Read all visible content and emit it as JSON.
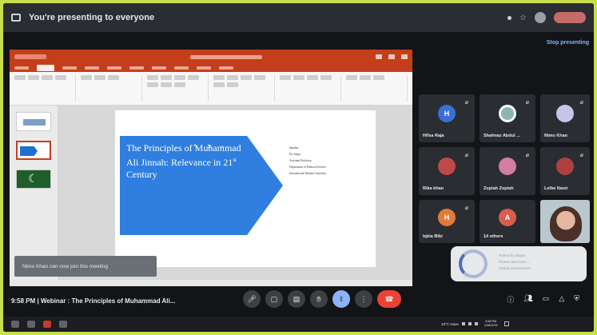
{
  "banner": {
    "text": "You're presenting to everyone",
    "stop_label": "Stop presenting"
  },
  "slide": {
    "title_main": "The Principles of Muhammad Ali Jinnah: Relevance in 21",
    "title_sup": "st",
    "title_end": "Century",
    "speaker_lines": [
      "Speaker",
      "Dr. Zaigu",
      "",
      "Assistant Professor,",
      "Department of Political Science",
      "International Women University"
    ]
  },
  "toast": {
    "text": "Nimo Khan can now join this meeting"
  },
  "participants": [
    {
      "name": "Hifsa Raja",
      "initial": "H",
      "color": "#3b6fd8"
    },
    {
      "name": "Shahnaz Abdul ...",
      "initial": "",
      "color": "#8bb6b0"
    },
    {
      "name": "Nimo Khan",
      "initial": "",
      "color": "#c9c3e8"
    },
    {
      "name": "Rika khan",
      "initial": "",
      "color": "#c04848"
    },
    {
      "name": "Zopiah Zopiah",
      "initial": "",
      "color": "#d37ca4"
    },
    {
      "name": "Lelbe Nasir",
      "initial": "",
      "color": "#b04040"
    },
    {
      "name": "Iqbia Bibi",
      "initial": "H",
      "color": "#e07a3b"
    },
    {
      "name": "14 others",
      "initial": "A",
      "color": "#d95c4c"
    }
  ],
  "popup": {
    "lines": [
      "Tested by Bogor",
      "Please and learn ...",
      "Global Government"
    ]
  },
  "meeting": {
    "time": "9:58 PM",
    "separator": "|",
    "title": "Webinar : The Principles of Muhammad Ali..."
  },
  "taskbar": {
    "weather": "19°C Haze",
    "time": "9:58 PM",
    "date": "1/28/2022"
  }
}
